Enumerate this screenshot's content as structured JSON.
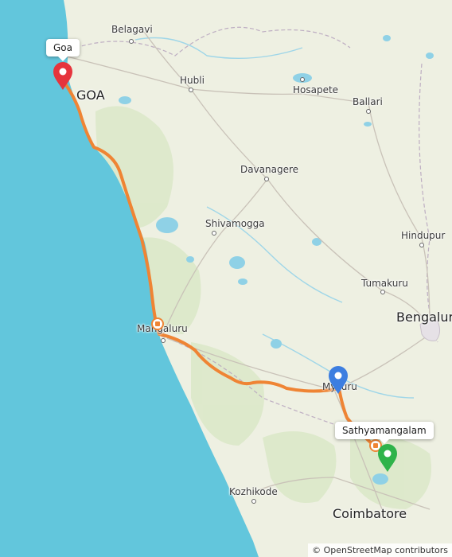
{
  "map": {
    "cities": {
      "belagavi": "Belagavi",
      "goa": "GOA",
      "hubli": "Hubli",
      "hosapete": "Hosapete",
      "ballari": "Ballari",
      "davanagere": "Davanagere",
      "shivamogga": "Shivamogga",
      "hindupur": "Hindupur",
      "tumakuru": "Tumakuru",
      "bengaluru": "Bengalur",
      "mangaluru": "Mangaluru",
      "mysuru": "Mysuru",
      "kozhikode": "Kozhikode",
      "coimbatore": "Coimbatore"
    },
    "markers": {
      "start_label": "Goa",
      "end_label": "Sathyamangalam"
    },
    "colors": {
      "route": "#ef8434",
      "sea": "#62c6dc",
      "land": "#eef0e2",
      "start_marker": "#e6343d",
      "waypoint_marker": "#3d7ee0",
      "end_marker": "#2fb34a"
    },
    "icons": {
      "start": "map-pin-red",
      "waypoint": "map-pin-blue",
      "end": "map-pin-green",
      "stops": "bus-stop-icon"
    },
    "attribution": "© OpenStreetMap contributors"
  }
}
